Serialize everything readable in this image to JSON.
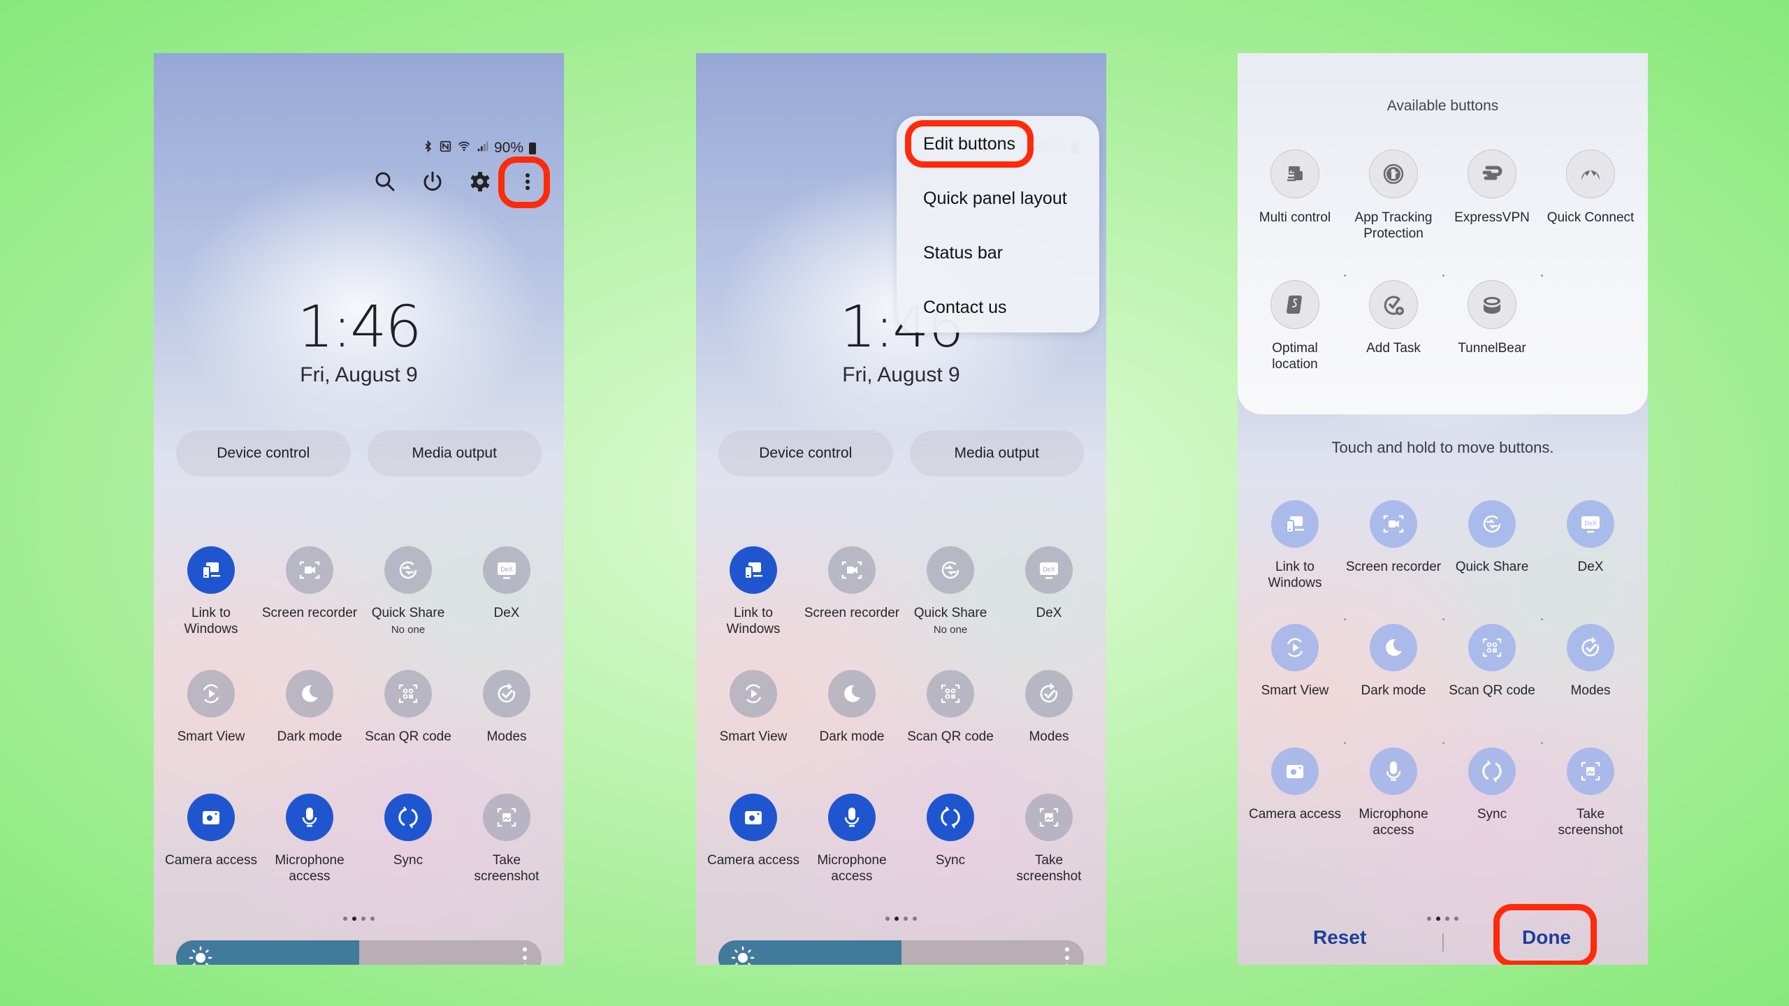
{
  "status_bar": {
    "icons": [
      "bluetooth-icon",
      "nfc-icon",
      "wifi-icon",
      "signal-icon"
    ],
    "battery": "90%"
  },
  "top_actions": [
    "search-icon",
    "power-icon",
    "settings-icon",
    "more-options-icon"
  ],
  "lock": {
    "time": "1:46",
    "date": "Fri, August 9"
  },
  "pills": {
    "device_control": "Device control",
    "media_output": "Media output"
  },
  "tiles": [
    {
      "label": "Link to\nWindows",
      "icon": "link-to-windows-icon",
      "on": true
    },
    {
      "label": "Screen recorder",
      "icon": "screen-recorder-icon",
      "on": false
    },
    {
      "label": "Quick Share",
      "sub": "No one",
      "icon": "quick-share-icon",
      "on": false
    },
    {
      "label": "DeX",
      "icon": "dex-icon",
      "on": false
    },
    {
      "label": "Smart View",
      "icon": "smart-view-icon",
      "on": false
    },
    {
      "label": "Dark mode",
      "icon": "dark-mode-icon",
      "on": false
    },
    {
      "label": "Scan QR code",
      "icon": "qr-code-icon",
      "on": false
    },
    {
      "label": "Modes",
      "icon": "modes-icon",
      "on": false
    },
    {
      "label": "Camera access",
      "icon": "camera-icon",
      "on": true
    },
    {
      "label": "Microphone\naccess",
      "icon": "microphone-icon",
      "on": true
    },
    {
      "label": "Sync",
      "icon": "sync-icon",
      "on": true
    },
    {
      "label": "Take\nscreenshot",
      "icon": "screenshot-icon",
      "on": false
    }
  ],
  "page_indicator": {
    "total": 4,
    "current": 2
  },
  "brightness": {
    "level_percent": 50
  },
  "overflow_menu": {
    "items": [
      "Edit buttons",
      "Quick panel layout",
      "Status bar",
      "Contact us"
    ],
    "highlighted": "Edit buttons"
  },
  "edit_mode": {
    "available_title": "Available buttons",
    "available": [
      {
        "label": "Multi control",
        "icon": "multi-control-icon"
      },
      {
        "label": "App Tracking\nProtection",
        "icon": "duckduckgo-icon"
      },
      {
        "label": "ExpressVPN",
        "icon": "expressvpn-icon"
      },
      {
        "label": "Quick Connect",
        "icon": "nordvpn-icon"
      },
      {
        "label": "Optimal\nlocation",
        "icon": "surfshark-icon"
      },
      {
        "label": "Add Task",
        "icon": "add-task-icon"
      },
      {
        "label": "TunnelBear",
        "icon": "tunnelbear-icon"
      }
    ],
    "hint": "Touch and hold to move buttons.",
    "edit_tiles": [
      "Link to\nWindows",
      "Screen recorder",
      "Quick Share",
      "DeX",
      "Smart View",
      "Dark mode",
      "Scan QR code",
      "Modes",
      "Camera access",
      "Microphone\naccess",
      "Sync",
      "Take\nscreenshot"
    ],
    "reset": "Reset",
    "done": "Done"
  },
  "colors": {
    "active_tile": "#1f56d0",
    "highlight": "#ff2a0a",
    "action_text": "#1d3f9a",
    "brightness_fill": "#427a9c"
  }
}
